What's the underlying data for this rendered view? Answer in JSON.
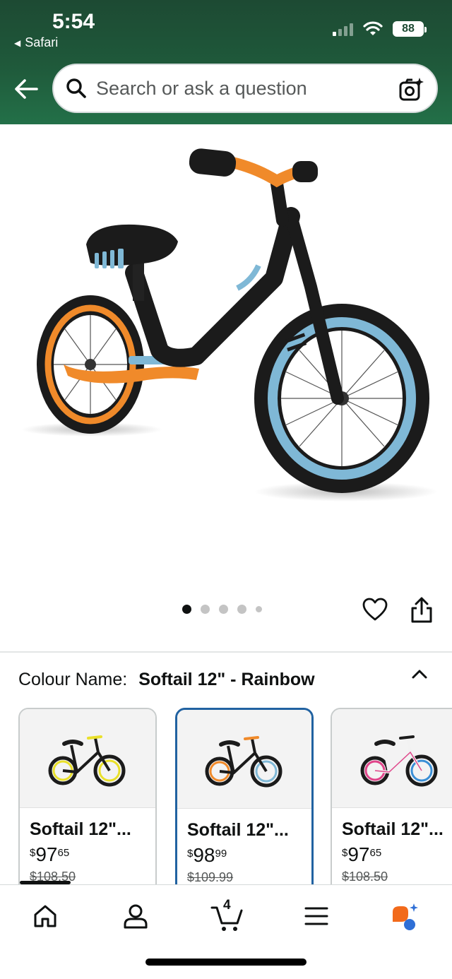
{
  "status_bar": {
    "time": "5:54",
    "back_app": "Safari",
    "battery": "88"
  },
  "search": {
    "placeholder": "Search or ask a question"
  },
  "gallery": {
    "dot_count": 5,
    "active_index": 0
  },
  "colour": {
    "label": "Colour Name:",
    "value": "Softail 12\" - Rainbow"
  },
  "variants": [
    {
      "name": "Softail 12\"...",
      "currency": "$",
      "whole": "97",
      "fraction": "65",
      "old_price": "$108.50",
      "accent": "#e9e02a",
      "selected": false
    },
    {
      "name": "Softail 12\"...",
      "currency": "$",
      "whole": "98",
      "fraction": "99",
      "old_price": "$109.99",
      "accent": "#f08a2a",
      "selected": true
    },
    {
      "name": "Softail 12\"...",
      "currency": "$",
      "whole": "97",
      "fraction": "65",
      "old_price": "$108.50",
      "accent": "#e0458a",
      "selected": false
    }
  ],
  "nav": {
    "cart_count": "4",
    "items": [
      "home-icon",
      "account-icon",
      "cart-icon",
      "menu-icon",
      "rufus-icon"
    ]
  },
  "colors": {
    "header_dark": "#1d4a33",
    "selected_border": "#2162a1",
    "product_orange": "#f08a2a",
    "product_blue": "#7fb8d6"
  }
}
